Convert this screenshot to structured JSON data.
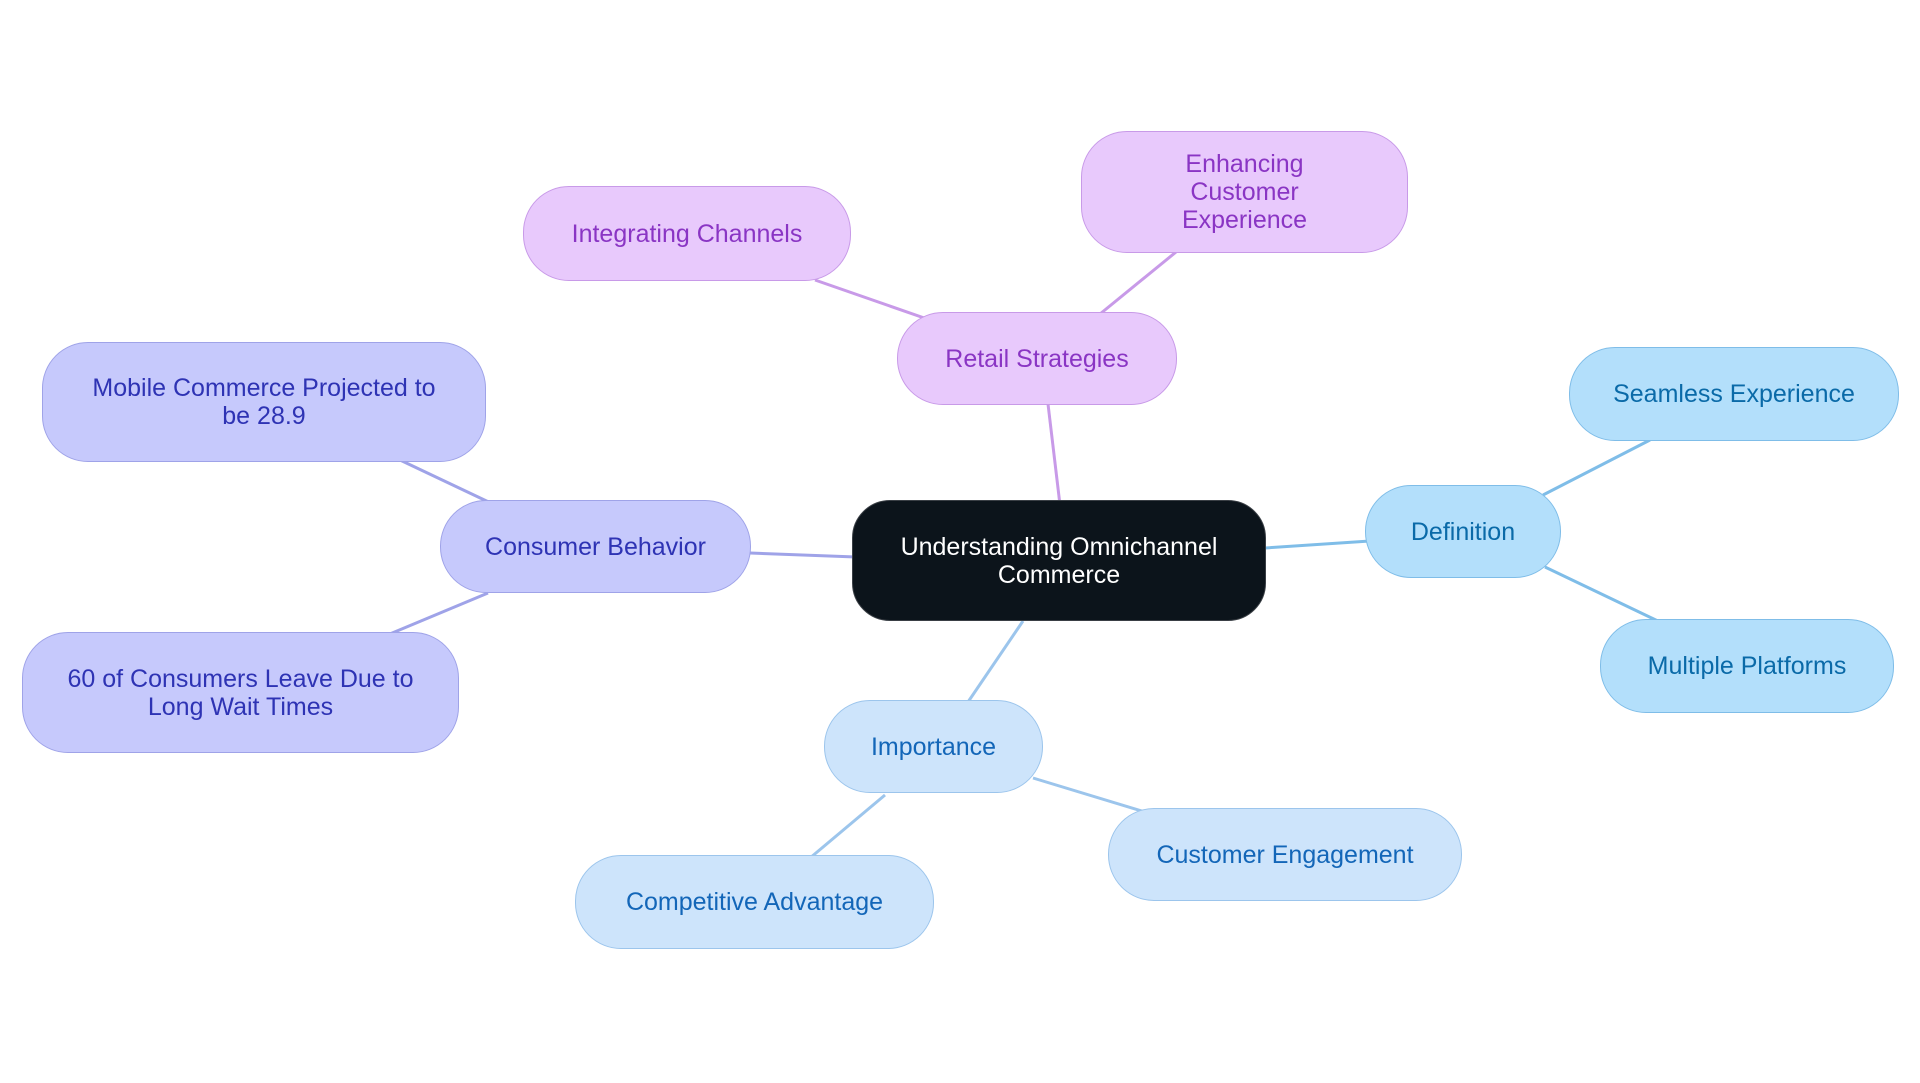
{
  "diagram": {
    "type": "mind-map",
    "root": {
      "id": "root",
      "label": "Understanding Omnichannel Commerce"
    },
    "colors": {
      "retail": "#c89ae8",
      "consumer": "#9fa3e8",
      "definition": "#7fbde8",
      "importance": "#9cc5ec"
    },
    "branches": [
      {
        "id": "retail",
        "label": "Retail Strategies",
        "children": [
          {
            "id": "integrating",
            "label": "Integrating Channels"
          },
          {
            "id": "enhancing",
            "label": "Enhancing Customer Experience"
          }
        ]
      },
      {
        "id": "consumer",
        "label": "Consumer Behavior",
        "children": [
          {
            "id": "mobile",
            "label": "Mobile Commerce Projected to be 28.9"
          },
          {
            "id": "wait",
            "label": "60 of Consumers Leave Due to Long Wait Times"
          }
        ]
      },
      {
        "id": "definition",
        "label": "Definition",
        "children": [
          {
            "id": "seamless",
            "label": "Seamless Experience"
          },
          {
            "id": "platforms",
            "label": "Multiple Platforms"
          }
        ]
      },
      {
        "id": "importance",
        "label": "Importance",
        "children": [
          {
            "id": "competitive",
            "label": "Competitive Advantage"
          },
          {
            "id": "engagement",
            "label": "Customer Engagement"
          }
        ]
      }
    ]
  }
}
